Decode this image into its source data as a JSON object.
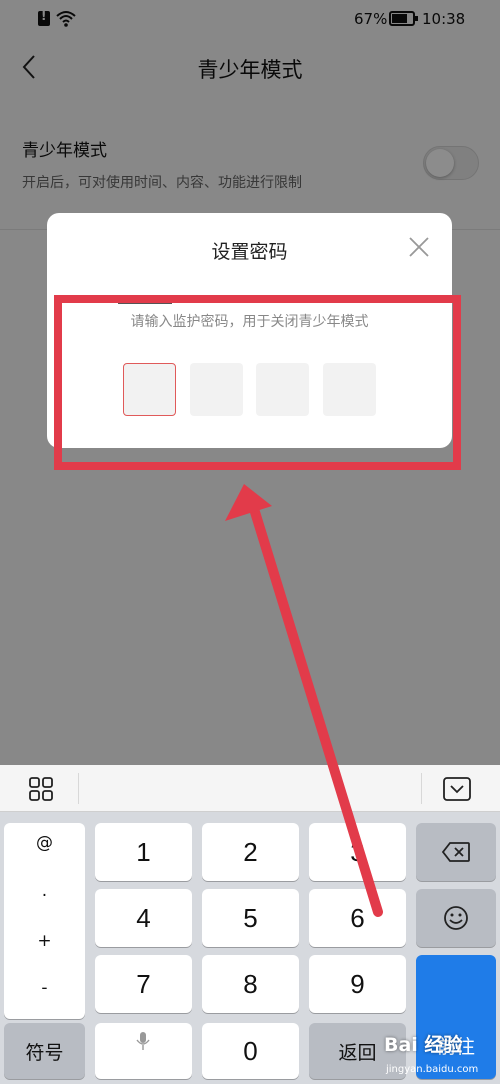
{
  "status_bar": {
    "battery": "67%",
    "time": "10:38"
  },
  "navbar": {
    "title": "青少年模式"
  },
  "setting": {
    "title": "青少年模式",
    "description": "开启后，可对使用时间、内容、功能进行限制",
    "enabled": false
  },
  "dialog": {
    "title": "设置密码",
    "hint": "请输入监护密码，用于关闭青少年模式",
    "pin_length": 4
  },
  "keyboard": {
    "symbols": [
      "@",
      ".",
      "+",
      "-"
    ],
    "digits": [
      "1",
      "2",
      "3",
      "4",
      "5",
      "6",
      "7",
      "8",
      "9",
      "0"
    ],
    "symbol_key": "符号",
    "back_key": "返回",
    "go_key": "前往"
  },
  "watermark": {
    "main": "Bai 经验",
    "sub": "jingyan.baidu.com"
  },
  "colors": {
    "accent": "#1f7ce8",
    "annotation": "#e23b4a",
    "pin_active_border": "#e05a5a"
  },
  "icons": [
    "sim-alert-icon",
    "wifi-icon",
    "battery-icon",
    "back-icon",
    "close-icon",
    "grid-icon",
    "keyboard-hide-icon",
    "backspace-icon",
    "emoji-icon",
    "mic-icon"
  ]
}
